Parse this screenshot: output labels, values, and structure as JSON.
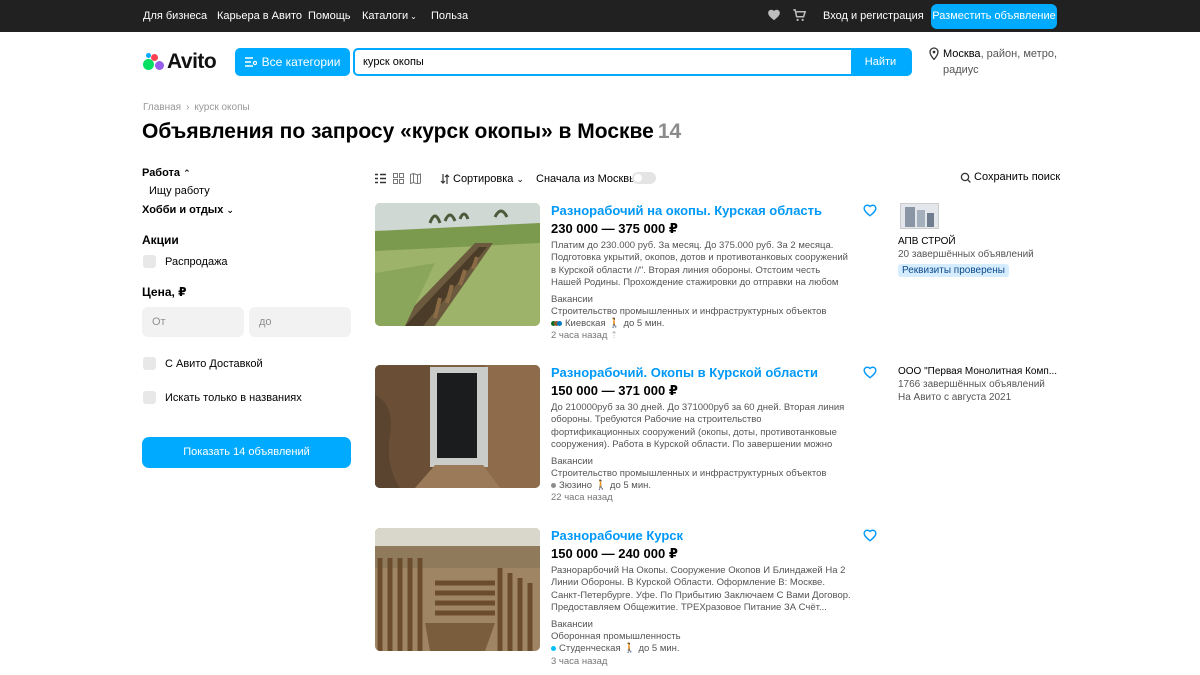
{
  "topbar": {
    "business": "Для бизнеса",
    "career": "Карьера в Авито",
    "help": "Помощь",
    "catalogs": "Каталоги",
    "benefit": "Польза",
    "login": "Вход и регистрация",
    "place_ad": "Разместить объявление"
  },
  "header": {
    "logo": "Avito",
    "categories_button": "Все категории",
    "search_value": "курск окопы",
    "search_button": "Найти",
    "location_city": "Москва",
    "location_rest": ", район, метро, радиус"
  },
  "breadcrumb": {
    "home": "Главная",
    "current": "курск окопы"
  },
  "title": {
    "text": "Объявления по запросу «курск окопы» в Москве",
    "count": "14"
  },
  "sidebar": {
    "category": "Работа",
    "subcategory": "Ищу работу",
    "hobby": "Хобби и отдых",
    "promos_heading": "Акции",
    "sale": "Распродажа",
    "price_heading": "Цена, ₽",
    "price_from_placeholder": "От",
    "price_to_placeholder": "до",
    "delivery": "С Авито Доставкой",
    "titles_only": "Искать только в названиях",
    "show_button": "Показать 14 объявлений"
  },
  "toolbar": {
    "sort": "Сортировка",
    "moscow_first": "Сначала из Москвы",
    "save_search": "Сохранить поиск"
  },
  "listings": [
    {
      "title": "Разнорабочий на окопы. Курская область",
      "price": "230 000 — 375 000 ₽",
      "description": "Платим до 230.000 руб. За месяц. До 375.000 руб. За 2 месяца. Подготовка укрытий, окопов, дотов и противотанковых сооружений в Курской области //\". Вторая линия обороны. Отстоим честь Нашей Родины. Прохождение стажировки до отправки на любом нашем...",
      "category": "Вакансии",
      "industry": "Строительство промышленных и инфраструктурных объектов",
      "metro": "Киевская",
      "walk": "до 5 мин.",
      "time": "2 часа назад",
      "seller_name": "АПВ СТРОЙ",
      "seller_info": "20 завершённых объявлений",
      "seller_extra": "",
      "seller_badge": "Реквизиты проверены"
    },
    {
      "title": "Разнорабочий. Окопы в Курской области",
      "price": "150 000 — 371 000 ₽",
      "description": "До 210000руб за 30 дней. До 371000руб за 60 дней. Вторая линия обороны. Требуются Рабочие на строительство фортификационных сооружений (окопы, доты, противотанковые сооружения). Работа в Курской области. По завершении можно остаться работать в...",
      "category": "Вакансии",
      "industry": "Строительство промышленных и инфраструктурных объектов",
      "metro": "Зюзино",
      "walk": "до 5 мин.",
      "time": "22 часа назад",
      "seller_name": "ООО \"Первая Монолитная Комп...",
      "seller_info": "1766 завершённых объявлений",
      "seller_extra": "На Авито с августа 2021",
      "seller_badge": ""
    },
    {
      "title": "Разнорабочие Курск",
      "price": "150 000 — 240 000 ₽",
      "description": "Разнорарбочий На Окопы. Сооружение Окопов И Блиндажей На 2 Линии Обороны. В Курской Области. Оформление В: Москве. Санкт-Петербурге. Уфе. По Прибытию Заключаем С Вами Договор. Предоставляем Общежитие. ТРЕХразовое Питание ЗА Счёт...",
      "category": "Вакансии",
      "industry": "Оборонная промышленность",
      "metro": "Студенческая",
      "walk": "до 5 мин.",
      "time": "3 часа назад",
      "seller_name": "",
      "seller_info": "",
      "seller_extra": "",
      "seller_badge": ""
    }
  ],
  "colors": {
    "accent": "#00aaff",
    "link": "#0099f7",
    "topbar": "#212121"
  },
  "icons": [
    "heart-icon",
    "cart-icon",
    "menu-icon",
    "pin-icon",
    "sort-icon",
    "save-search-icon",
    "list-view-icon",
    "grid-view-icon",
    "map-view-icon",
    "favorite-icon",
    "walk-icon"
  ]
}
